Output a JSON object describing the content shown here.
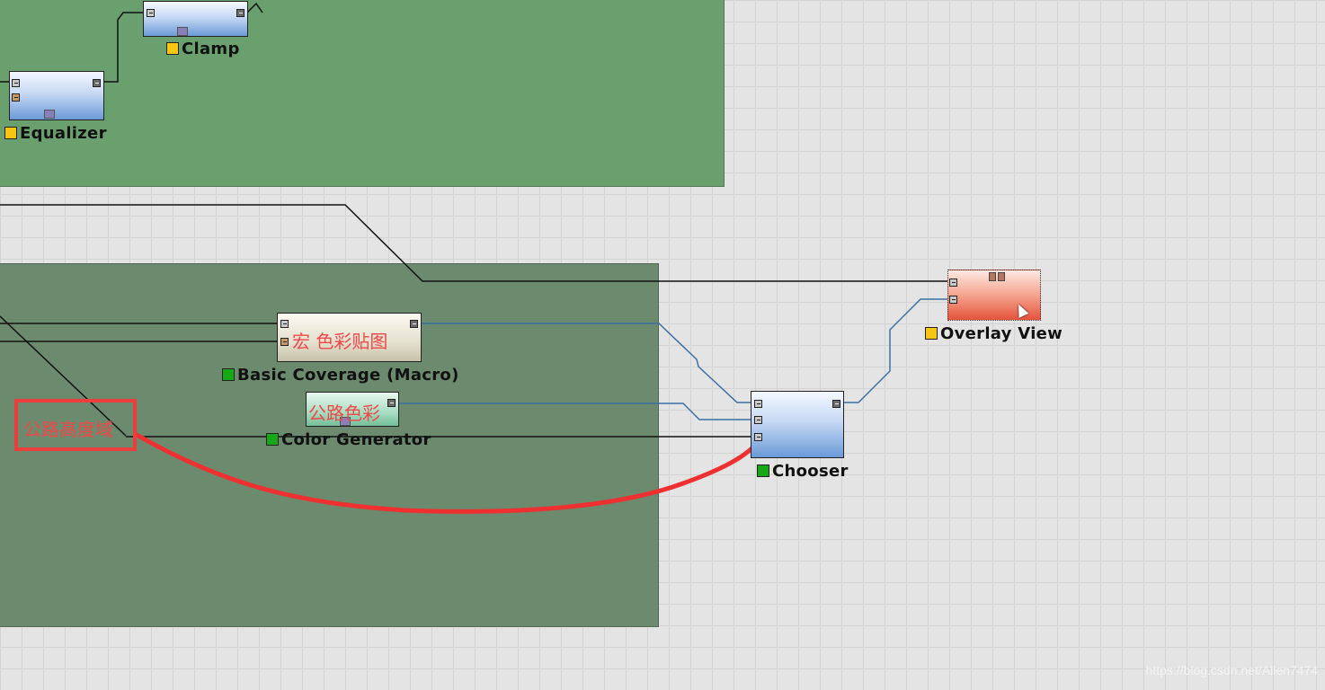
{
  "nodes": {
    "clamp": "Clamp",
    "equalizer": "Equalizer",
    "basic_coverage": "Basic Coverage (Macro)",
    "color_generator": "Color Generator",
    "chooser": "Chooser",
    "overlay_view": "Overlay View"
  },
  "annotations": {
    "macro_color_map": "宏 色彩贴图",
    "road_color": "公路色彩",
    "road_height_field": "公路高度域"
  },
  "watermark": "https://blog.csdn.net/Allen7474",
  "colors": {
    "group_top": "#6aa06e",
    "group_bottom": "#6b8a6e",
    "annotation_red": "#f04848",
    "status_yellow": "#f7c512",
    "status_green": "#17a817"
  }
}
